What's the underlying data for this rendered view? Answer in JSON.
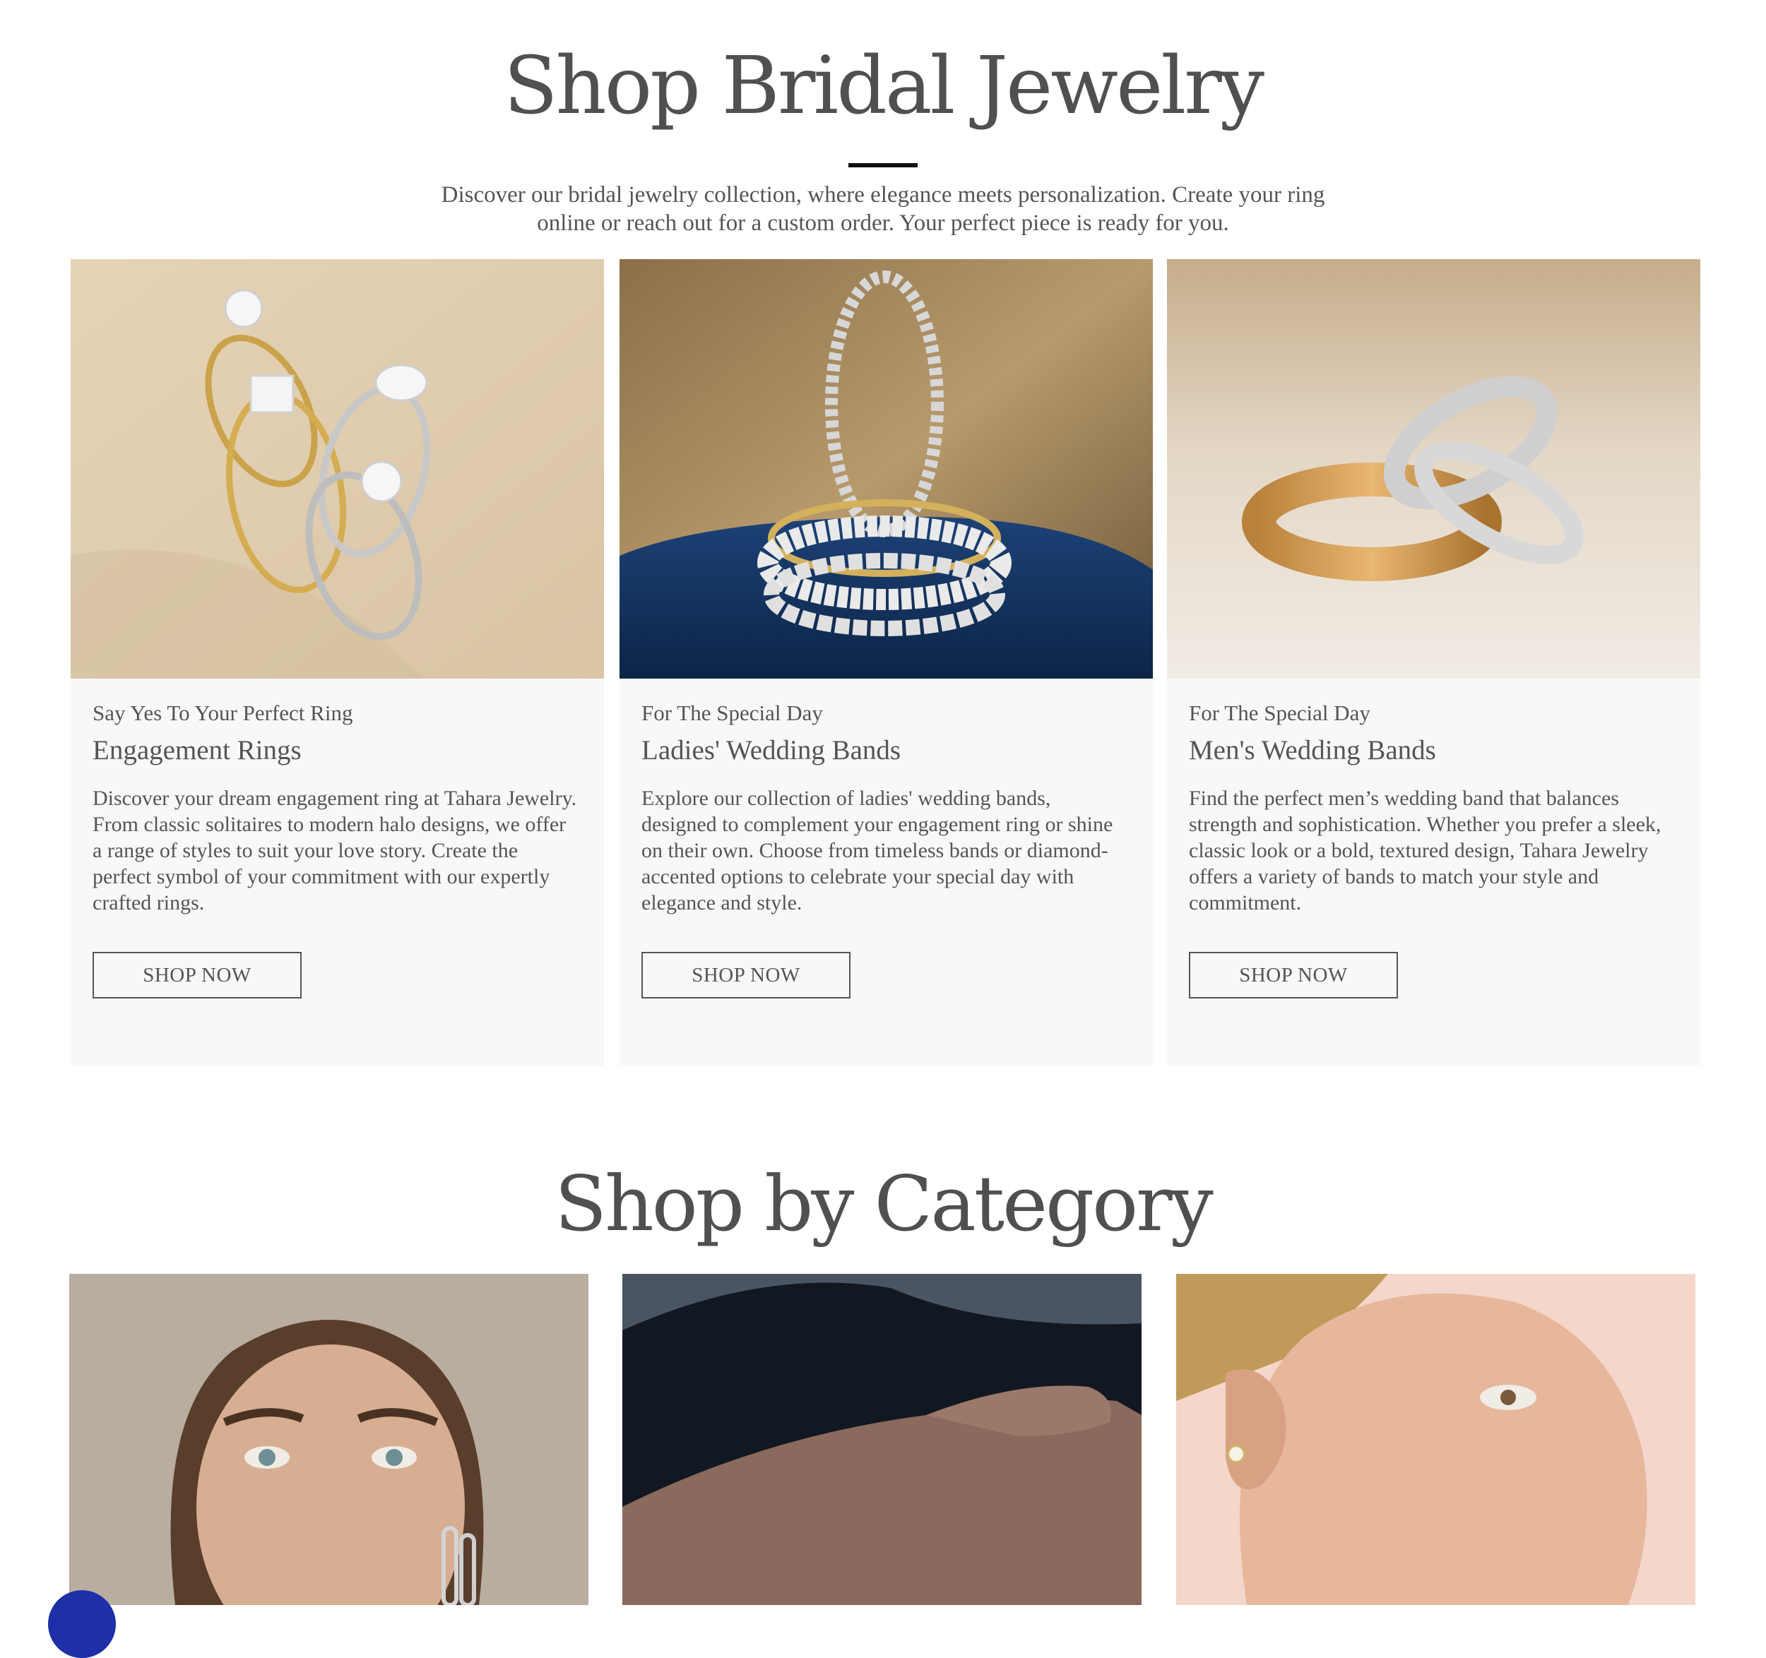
{
  "bridal": {
    "title": "Shop Bridal Jewelry",
    "intro": "Discover our bridal jewelry collection, where elegance meets personalization. Create your ring online or reach out for a custom order. Your perfect piece is ready for you.",
    "cards": [
      {
        "eyebrow": "Say Yes To Your Perfect Ring",
        "heading": "Engagement Rings",
        "description": "Discover your dream engagement ring at Tahara Jewelry. From classic solitaires to modern halo designs, we offer a range of styles to suit your love story. Create the perfect symbol of your commitment with our expertly crafted rings.",
        "button": "SHOP NOW"
      },
      {
        "eyebrow": "For The Special Day",
        "heading": "Ladies' Wedding Bands",
        "description": "Explore our collection of ladies' wedding bands, designed to complement your engagement ring or shine on their own. Choose from timeless bands or diamond-accented options to celebrate your special day with elegance and style.",
        "button": "SHOP NOW"
      },
      {
        "eyebrow": "For The Special Day",
        "heading": "Men's Wedding Bands",
        "description": "Find the perfect men’s wedding band that balances strength and sophistication. Whether you prefer a sleek, classic look or a bold, textured design, Tahara Jewelry offers a variety of bands to match your style and commitment.",
        "button": "SHOP NOW"
      }
    ]
  },
  "category": {
    "title": "Shop by Category"
  },
  "colors": {
    "text": "#4a4a4a",
    "card_bg": "#f8f8f8",
    "divider": "#111111",
    "chat_button": "#1e2fa8"
  }
}
